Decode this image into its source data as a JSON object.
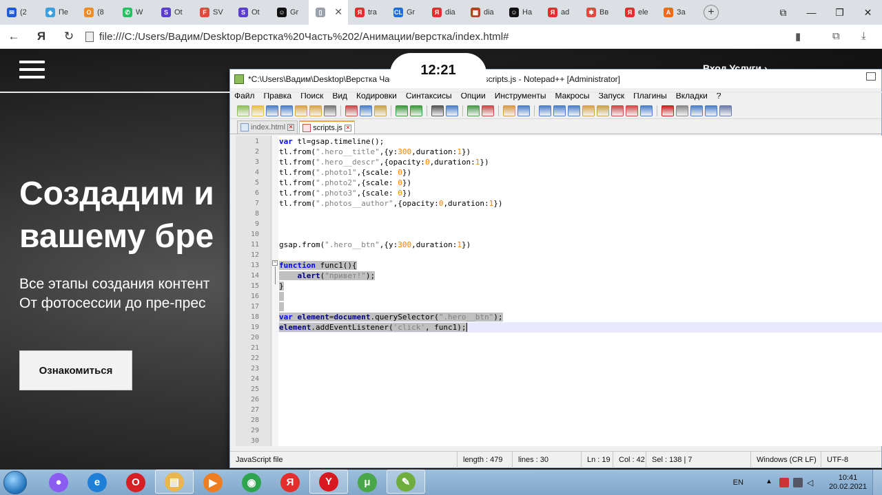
{
  "browser": {
    "tabs": [
      {
        "label": "(2",
        "color": "#1e5bd6",
        "glyph": "✉"
      },
      {
        "label": "Пе",
        "color": "#3da0e0",
        "glyph": "◆"
      },
      {
        "label": "(8",
        "color": "#f08a24",
        "glyph": "О"
      },
      {
        "label": "W",
        "color": "#25c160",
        "glyph": "✆"
      },
      {
        "label": "Ot",
        "color": "#5b3ecf",
        "glyph": "S"
      },
      {
        "label": "SV",
        "color": "#e04a3a",
        "glyph": "F"
      },
      {
        "label": "Ot",
        "color": "#5b3ecf",
        "glyph": "S"
      },
      {
        "label": "Gr",
        "color": "#111111",
        "glyph": "☺"
      },
      {
        "label": "",
        "color": "#9aa3ad",
        "glyph": "▯",
        "active": true
      },
      {
        "label": "tra",
        "color": "#e52d2d",
        "glyph": "Я"
      },
      {
        "label": "Gr",
        "color": "#1e6fd9",
        "glyph": "CL"
      },
      {
        "label": "dia",
        "color": "#e52d2d",
        "glyph": "Я"
      },
      {
        "label": "dia",
        "color": "#b3451e",
        "glyph": "▦"
      },
      {
        "label": "Ha",
        "color": "#111111",
        "glyph": "☺"
      },
      {
        "label": "ad",
        "color": "#e52d2d",
        "glyph": "Я"
      },
      {
        "label": "Вв",
        "color": "#e04a3a",
        "glyph": "✱"
      },
      {
        "label": "ele",
        "color": "#e52d2d",
        "glyph": "Я"
      },
      {
        "label": "За",
        "color": "#f06a1a",
        "glyph": "A"
      }
    ],
    "new_tab": "+",
    "window_controls": [
      "⧉",
      "—",
      "❐",
      "✕"
    ],
    "nav": {
      "back": "←",
      "logo": "Я",
      "reload": "↻"
    },
    "url": "file:///C:/Users/Вадим/Desktop/Верстка%20Часть%202/Анимации/верстка/index.html#",
    "right_icons": [
      "▮",
      "⧉",
      "⤓"
    ]
  },
  "page": {
    "clock": "12:21",
    "top_nav": "Вход          Услуги       ›",
    "hero_title_1": "Создадим и",
    "hero_title_2": "вашему бре",
    "hero_descr_1": "Все этапы создания контент",
    "hero_descr_2": "От фотосессии до пре-прес",
    "hero_button": "Ознакомиться"
  },
  "npp": {
    "title": "*C:\\Users\\Вадим\\Desktop\\Верстка Часть 2\\Анимации\\верстка\\scripts.js - Notepad++ [Administrator]",
    "menu": [
      "Файл",
      "Правка",
      "Поиск",
      "Вид",
      "Кодировки",
      "Синтаксисы",
      "Опции",
      "Инструменты",
      "Макросы",
      "Запуск",
      "Плагины",
      "Вкладки",
      "?"
    ],
    "tabs": [
      {
        "label": "index.html",
        "active": false
      },
      {
        "label": "scripts.js",
        "active": true
      }
    ],
    "line_numbers": [
      "1",
      "2",
      "3",
      "4",
      "5",
      "6",
      "7",
      "8",
      "9",
      "10",
      "11",
      "12",
      "13",
      "14",
      "15",
      "16",
      "17",
      "18",
      "19",
      "20",
      "21",
      "22",
      "23",
      "24",
      "25",
      "26",
      "27",
      "28",
      "29",
      "30"
    ],
    "status": {
      "type": "JavaScript file",
      "length": "length : 479",
      "lines": "lines : 30",
      "ln": "Ln : 19",
      "col": "Col : 42",
      "sel": "Sel : 138 | 7",
      "eol": "Windows (CR LF)",
      "enc": "UTF-8"
    }
  },
  "taskbar": {
    "apps": [
      {
        "name": "alice",
        "color": "#8a5cf0",
        "glyph": "●"
      },
      {
        "name": "ie",
        "color": "#1f7fd6",
        "glyph": "e"
      },
      {
        "name": "opera",
        "color": "#d81f26",
        "glyph": "O"
      },
      {
        "name": "explorer",
        "color": "#e8b64a",
        "glyph": "▤",
        "open": true
      },
      {
        "name": "media",
        "color": "#ef7d22",
        "glyph": "▶"
      },
      {
        "name": "chrome",
        "color": "#2ea44f",
        "glyph": "◉"
      },
      {
        "name": "yandex",
        "color": "#e52d2d",
        "glyph": "Я"
      },
      {
        "name": "yandex-browser",
        "color": "#d8191f",
        "glyph": "Y",
        "open": true
      },
      {
        "name": "utorrent",
        "color": "#4aa64a",
        "glyph": "μ"
      },
      {
        "name": "notepadpp",
        "color": "#6fae3c",
        "glyph": "✎",
        "open": true
      }
    ],
    "lang": "EN",
    "time": "10:41",
    "date": "20.02.2021"
  }
}
